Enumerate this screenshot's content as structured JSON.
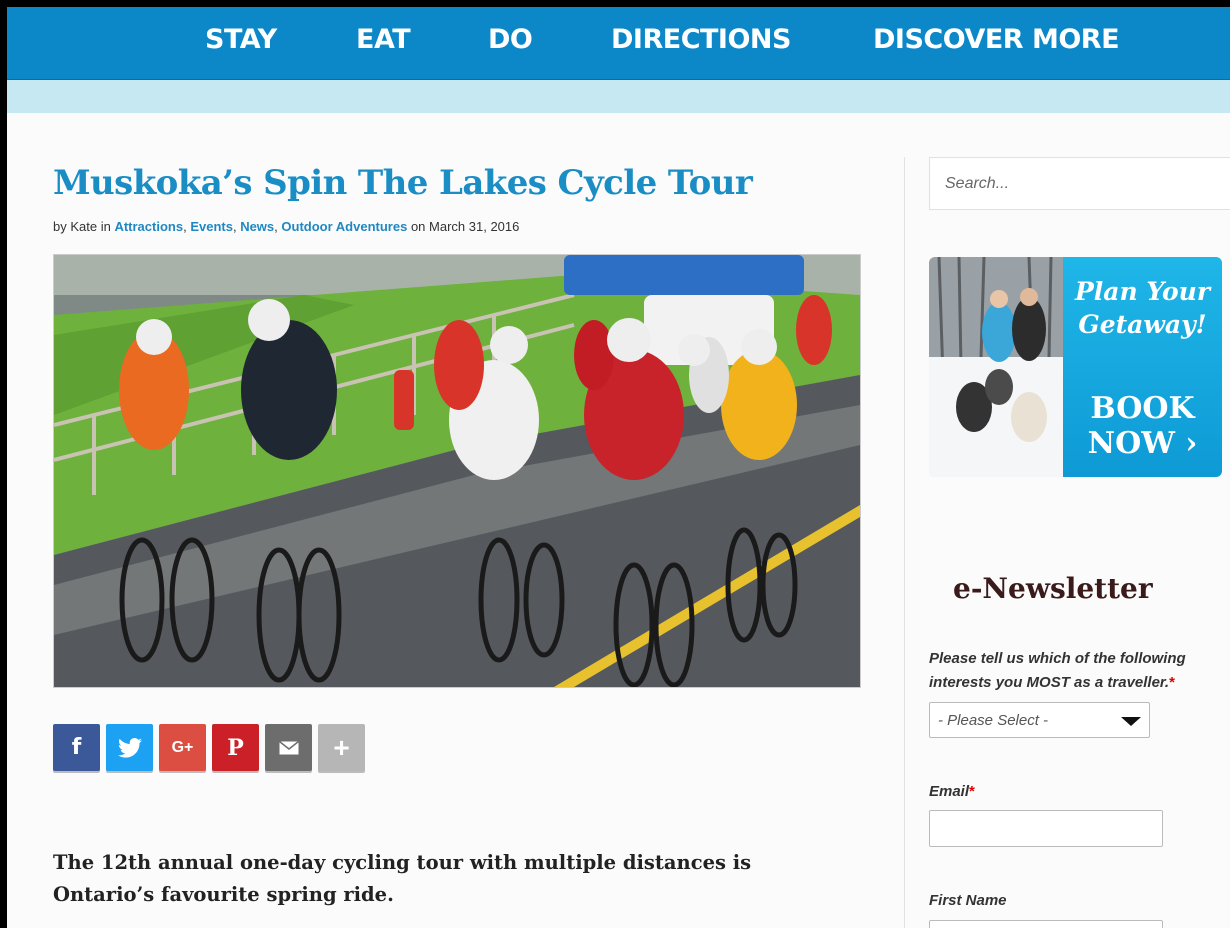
{
  "nav": {
    "items": [
      "STAY",
      "EAT",
      "DO",
      "DIRECTIONS",
      "DISCOVER MORE"
    ]
  },
  "article": {
    "title": "Muskoka’s Spin The Lakes Cycle Tour",
    "byline": {
      "prefix": "by Kate in",
      "categories": [
        "Attractions",
        "Events",
        "News",
        "Outdoor Adventures"
      ],
      "date_prefix": "on",
      "date": "March 31, 2016"
    },
    "lead_line1": "The 12th annual one-day cycling tour with multiple distances is",
    "lead_line2": "Ontario’s favourite spring ride."
  },
  "share": [
    {
      "name": "facebook-share-button",
      "icon": "facebook-icon",
      "glyph": "f",
      "color": "#3b5998"
    },
    {
      "name": "twitter-share-button",
      "icon": "twitter-icon",
      "glyph": "",
      "color": "#1da1f2"
    },
    {
      "name": "google-plus-share-button",
      "icon": "google-plus-icon",
      "glyph": "G+",
      "color": "#dc4e41"
    },
    {
      "name": "pinterest-share-button",
      "icon": "pinterest-icon",
      "glyph": "P",
      "color": "#cb2027"
    },
    {
      "name": "email-share-button",
      "icon": "email-icon",
      "glyph": "",
      "color": "#6d6d6d"
    },
    {
      "name": "more-share-button",
      "icon": "plus-icon",
      "glyph": "+",
      "color": "#b6b6b6"
    }
  ],
  "sidebar": {
    "search_placeholder": "Search...",
    "ad": {
      "line1": "Plan Your",
      "line2": "Getaway!",
      "line3": "BOOK",
      "line4": "NOW ›"
    },
    "newsletter": {
      "title": "e-Newsletter",
      "question_line1": "Please tell us which of the following",
      "question_line2": "interests you MOST as a traveller.",
      "required_mark": "*",
      "select_value": "- Please Select -",
      "email_label": "Email",
      "first_name_label": "First Name"
    }
  }
}
